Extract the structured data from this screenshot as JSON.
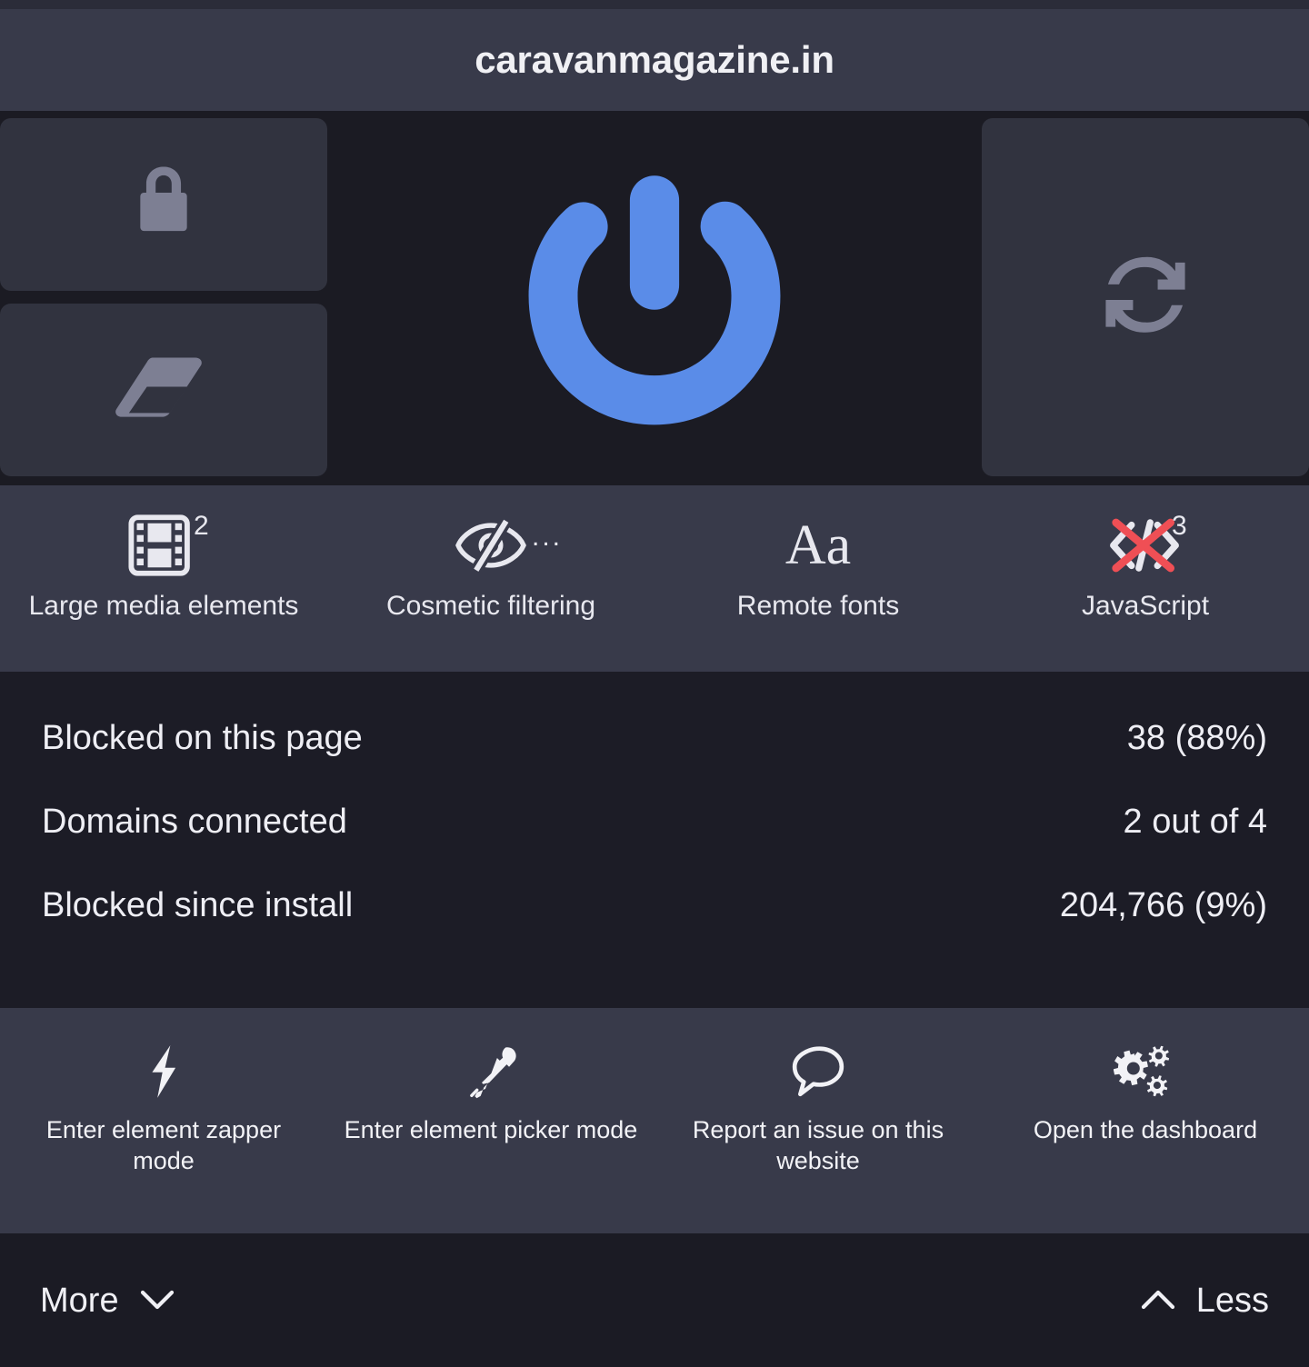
{
  "header": {
    "hostname": "caravanmagazine.in"
  },
  "power": {
    "power_icon": "power-icon",
    "power_color": "#5a8ce8",
    "lock_icon": "padlock-icon",
    "eraser_icon": "eraser-icon",
    "reload_icon": "reload-icon",
    "muted_icon_color": "#7d7f93"
  },
  "toggles": [
    {
      "label": "Large media elements",
      "icon": "film-strip-icon",
      "badge": "2",
      "suffix": ""
    },
    {
      "label": "Cosmetic filtering",
      "icon": "eye-slash-icon",
      "badge": "",
      "suffix": "..."
    },
    {
      "label": "Remote fonts",
      "icon": "font-aa-icon",
      "badge": "",
      "suffix": ""
    },
    {
      "label": "JavaScript",
      "icon": "code-brackets-crossed-icon",
      "badge": "3",
      "suffix": ""
    }
  ],
  "stats": [
    {
      "name": "Blocked on this page",
      "value": "38 (88%)"
    },
    {
      "name": "Domains connected",
      "value": "2 out of 4"
    },
    {
      "name": "Blocked since install",
      "value": "204,766 (9%)"
    }
  ],
  "tools": [
    {
      "label": "Enter element zapper mode",
      "icon": "lightning-bolt-icon"
    },
    {
      "label": "Enter element picker mode",
      "icon": "eyedropper-icon"
    },
    {
      "label": "Report an issue on this website",
      "icon": "speech-bubble-icon"
    },
    {
      "label": "Open the dashboard",
      "icon": "gears-icon"
    }
  ],
  "footer": {
    "more_label": "More",
    "more_icon": "chevron-down-icon",
    "less_label": "Less",
    "less_icon": "chevron-up-icon"
  },
  "colors": {
    "accent_blue": "#5a8ce8",
    "danger_red": "#ef4f55",
    "panel_bg": "#383a4a",
    "dark_bg": "#1b1b23",
    "stats_bg": "#1c1c26",
    "button_bg": "#31333f"
  }
}
